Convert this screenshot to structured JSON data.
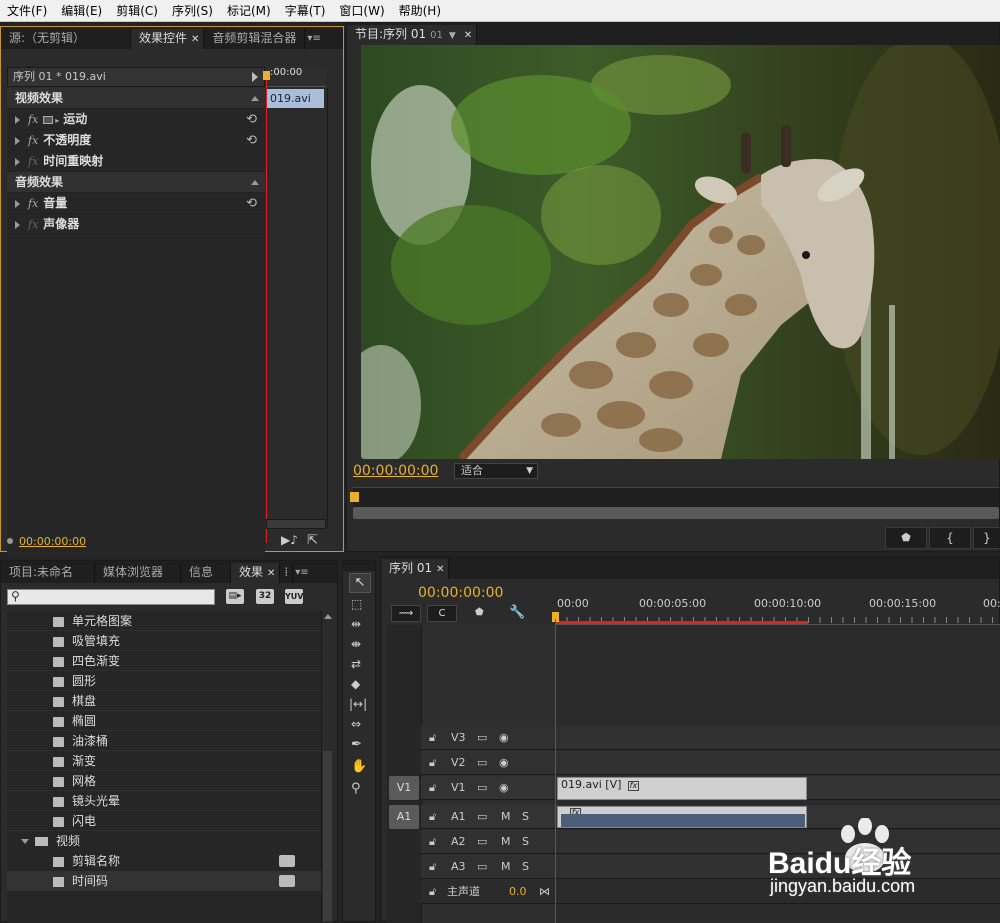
{
  "menu": [
    "文件(F)",
    "编辑(E)",
    "剪辑(C)",
    "序列(S)",
    "标记(M)",
    "字幕(T)",
    "窗口(W)",
    "帮助(H)"
  ],
  "source_panel": {
    "tabs": [
      "源:（无剪辑）",
      "效果控件",
      "音频剪辑混合器"
    ],
    "clip_header": "序列 01 * 019.avi",
    "timeline_clip": "019.avi",
    "ruler_time": ":00:00",
    "video_effects_label": "视频效果",
    "effects": [
      {
        "name": "运动"
      },
      {
        "name": "不透明度"
      },
      {
        "name": "时间重映射"
      }
    ],
    "audio_effects_label": "音频效果",
    "audio_effects": [
      {
        "name": "音量"
      },
      {
        "name": "声像器"
      }
    ],
    "timecode": "00:00:00:00"
  },
  "program_panel": {
    "tab": "节目:序列 01",
    "timecode": "00:00:00:00",
    "fit_label": "适合"
  },
  "project_panel": {
    "tabs": [
      "项目:未命名",
      "媒体浏览器",
      "信息",
      "效果"
    ],
    "search_placeholder": "",
    "items": [
      "单元格图案",
      "吸管填充",
      "四色渐变",
      "圆形",
      "棋盘",
      "椭圆",
      "油漆桶",
      "渐变",
      "网格",
      "镜头光晕",
      "闪电"
    ],
    "folder": "视频",
    "subitems": [
      "剪辑名称",
      "时间码"
    ]
  },
  "timeline": {
    "tab": "序列 01",
    "timecode": "00:00:00:00",
    "ruler": [
      "00:00",
      "00:00:05:00",
      "00:00:10:00",
      "00:00:15:00",
      "00:"
    ],
    "video_tracks": [
      {
        "name": "V3"
      },
      {
        "name": "V2"
      },
      {
        "name": "V1",
        "src": "V1"
      }
    ],
    "audio_tracks": [
      {
        "name": "A1",
        "src": "A1"
      },
      {
        "name": "A2"
      },
      {
        "name": "A3"
      }
    ],
    "master": "主声道",
    "master_value": "0.0",
    "video_clip": "019.avi [V]",
    "m": "M",
    "s": "S"
  },
  "watermark": {
    "brand": "Baidu经验",
    "url": "jingyan.baidu.com"
  },
  "colors": {
    "accent": "#e8b12a",
    "playhead": "#e02020",
    "clip_video": "#c8c8c8",
    "clip_audio": "#4d5e7a"
  }
}
